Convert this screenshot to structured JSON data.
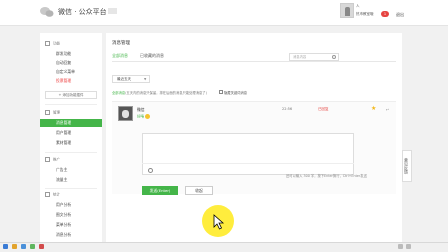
{
  "header": {
    "logo_text": "微信 · 公众平台",
    "account_name": "人",
    "account_sub": "热市教室哦",
    "notify_count": "1",
    "logout_label": "退出"
  },
  "sidebar": {
    "sections": [
      {
        "title": "功能",
        "items": [
          "群发功能",
          "自动回复",
          "自定义菜单",
          "投票管理"
        ]
      },
      {
        "title": "管理",
        "items": [
          "消息管理",
          "用户管理",
          "素材管理"
        ]
      },
      {
        "title": "推广",
        "items": [
          "广告主",
          "流量主"
        ]
      },
      {
        "title": "统计",
        "items": [
          "用户分析",
          "图文分析",
          "菜单分析",
          "消息分析"
        ]
      }
    ],
    "add_plugin_label": "+ 添加功能插件",
    "active_item": "消息管理"
  },
  "main": {
    "title": "消息管理",
    "tabs": [
      "全部消息",
      "已收藏的消息"
    ],
    "active_tab": "全部消息",
    "search_placeholder": "消息内容",
    "filter_label": "最近五天",
    "info_prefix": "全部消息",
    "info_text": "(五天内的消息只保留，排在后面的消息只能处理消息了)",
    "hide_keyword_label": "隐藏关键词消息",
    "message": {
      "sender": "微信",
      "text": "好咯",
      "time": "22:56",
      "status": "已回复"
    },
    "reply_hint": "还可以输入 300 字，按下Enter换行，Ctrl+Enter发送",
    "send_label": "发送(Enter)",
    "fold_label": "收起",
    "float_label": "意见反馈"
  },
  "colors": {
    "accent": "#44b549",
    "alert": "#e64340",
    "cursor_highlight": "#ffeb28"
  }
}
